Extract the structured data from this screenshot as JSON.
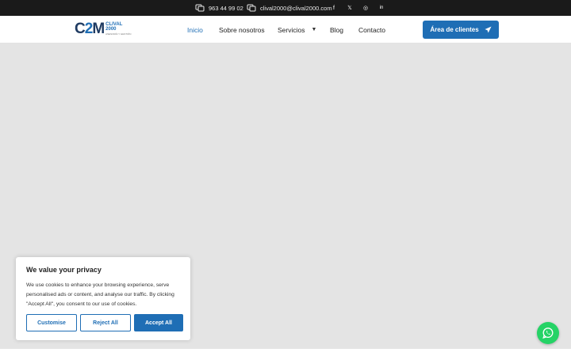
{
  "topbar": {
    "phone": "963 44 99 02",
    "email": "clival2000@clival2000.com",
    "social": [
      {
        "name": "facebook-icon",
        "glyph": "f"
      },
      {
        "name": "x-twitter-icon",
        "glyph": "𝕏"
      },
      {
        "name": "instagram-icon",
        "glyph": "◎"
      },
      {
        "name": "linkedin-icon",
        "glyph": "in"
      }
    ]
  },
  "header": {
    "logo": {
      "mark_left": "C",
      "mark_mid": "2",
      "mark_right": "M",
      "line1": "CLIVAL",
      "line2": "2000",
      "line3": "ASESORÍA Y GESTIÓN"
    },
    "nav": {
      "inicio": "Inicio",
      "sobre": "Sobre nosotros",
      "servicios": "Servicios",
      "blog": "Blog",
      "contacto": "Contacto"
    },
    "cta_label": "Área de clientes"
  },
  "cookie": {
    "title": "We value your privacy",
    "body": "We use cookies to enhance your browsing experience, serve personalised ads or content, and analyse our traffic. By clicking \"Accept All\", you consent to our use of cookies.",
    "customise": "Customise",
    "reject": "Reject All",
    "accept": "Accept All"
  },
  "colors": {
    "accent": "#1f6eb5",
    "topbar": "#1a1a1a",
    "hero": "#e4e4e4",
    "whatsapp": "#25d366"
  }
}
